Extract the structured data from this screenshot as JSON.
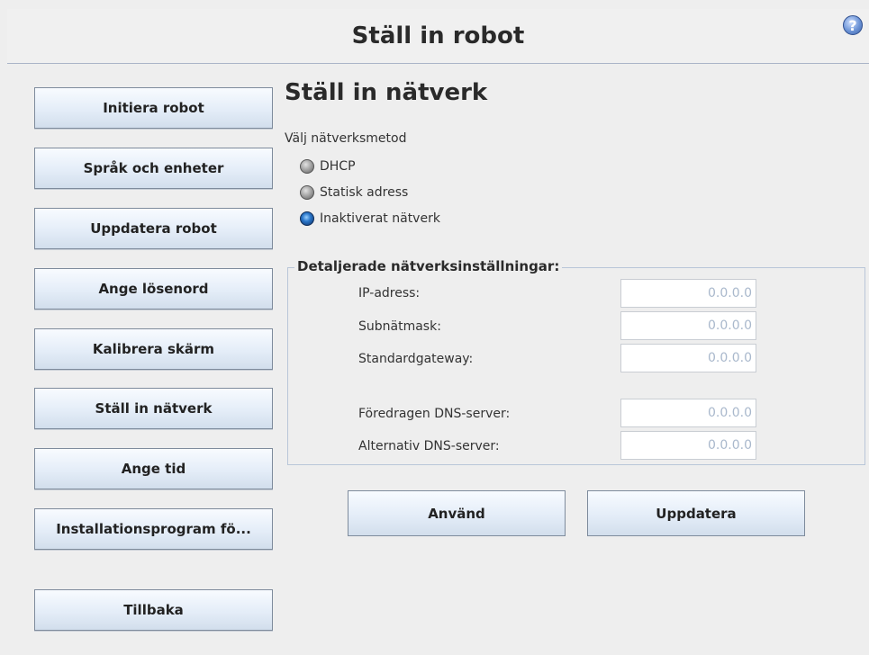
{
  "header": {
    "title": "Ställ in robot",
    "help_glyph": "?"
  },
  "sidebar": {
    "items": [
      {
        "label": "Initiera robot"
      },
      {
        "label": "Språk och enheter"
      },
      {
        "label": "Uppdatera robot"
      },
      {
        "label": "Ange lösenord"
      },
      {
        "label": "Kalibrera skärm"
      },
      {
        "label": "Ställ in nätverk"
      },
      {
        "label": "Ange tid"
      },
      {
        "label": "Installationsprogram fö..."
      }
    ],
    "back_label": "Tillbaka"
  },
  "main": {
    "title": "Ställ in nätverk",
    "method_label": "Välj nätverksmetod",
    "methods": [
      {
        "label": "DHCP",
        "selected": false
      },
      {
        "label": "Statisk adress",
        "selected": false
      },
      {
        "label": "Inaktiverat nätverk",
        "selected": true
      }
    ],
    "details": {
      "legend": "Detaljerade nätverksinställningar:",
      "fields": [
        {
          "label": "IP-adress:",
          "value": "0.0.0.0"
        },
        {
          "label": "Subnätmask:",
          "value": "0.0.0.0"
        },
        {
          "label": "Standardgateway:",
          "value": "0.0.0.0"
        },
        {
          "label": "Föredragen DNS-server:",
          "value": "0.0.0.0"
        },
        {
          "label": "Alternativ DNS-server:",
          "value": "0.0.0.0"
        }
      ]
    },
    "apply_label": "Använd",
    "refresh_label": "Uppdatera"
  },
  "colors": {
    "background": "#eeeeee",
    "button_gradient_top": "#f8fbff",
    "button_gradient_bottom": "#d2deec",
    "input_text": "#a9b8cc",
    "radio_selected": "#2a76c9",
    "help_icon": "#6b93d6"
  },
  "icons": {
    "help": "help-icon",
    "radio_off": "radio-unselected-icon",
    "radio_on": "radio-selected-icon"
  }
}
